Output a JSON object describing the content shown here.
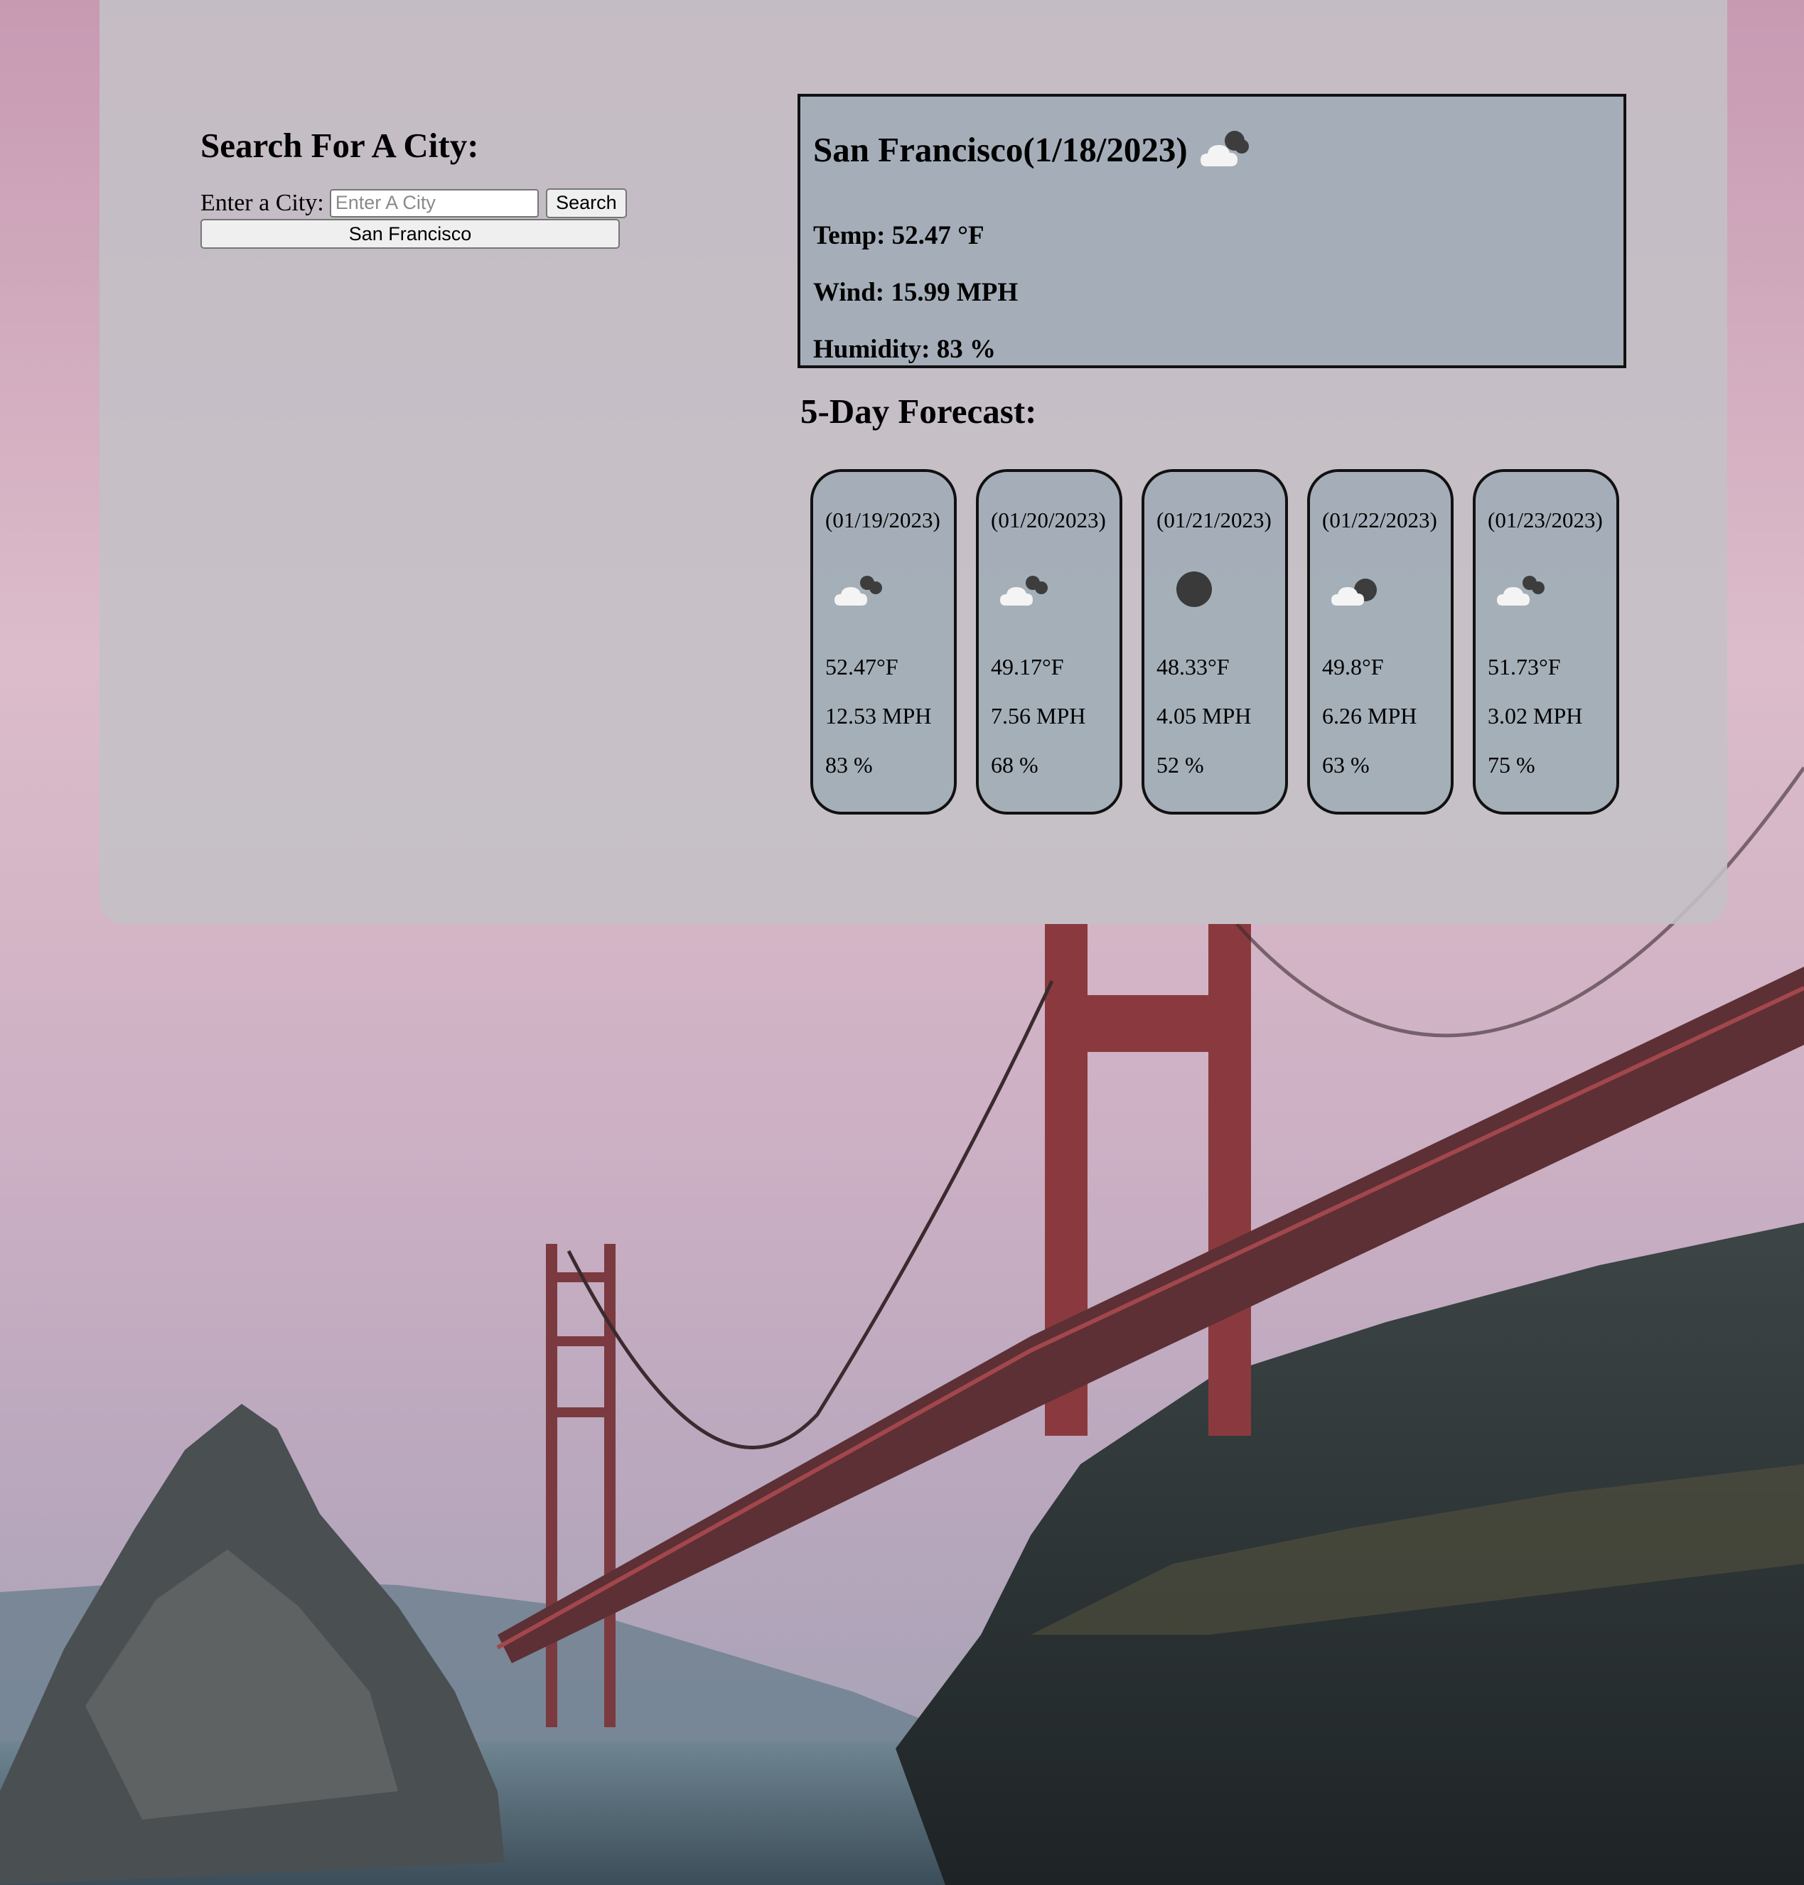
{
  "search": {
    "heading": "Search For A City:",
    "label": "Enter a City:",
    "placeholder": "Enter A City",
    "button_label": "Search",
    "history": [
      "San Francisco"
    ]
  },
  "current": {
    "city_date": "San Francisco(1/18/2023)",
    "icon": "few-clouds-icon",
    "temp": "Temp: 52.47 °F",
    "wind": "Wind: 15.99 MPH",
    "humidity": "Humidity: 83 %"
  },
  "forecast": {
    "heading": "5-Day Forecast:",
    "days": [
      {
        "date": "(01/19/2023)",
        "icon": "broken-clouds-icon",
        "temp": "52.47°F",
        "wind": "12.53 MPH",
        "humidity": "83 %"
      },
      {
        "date": "(01/20/2023)",
        "icon": "broken-clouds-icon",
        "temp": "49.17°F",
        "wind": "7.56 MPH",
        "humidity": "68 %"
      },
      {
        "date": "(01/21/2023)",
        "icon": "clear-sky-icon",
        "temp": "48.33°F",
        "wind": "4.05 MPH",
        "humidity": "52 %"
      },
      {
        "date": "(01/22/2023)",
        "icon": "few-clouds-icon",
        "temp": "49.8°F",
        "wind": "6.26 MPH",
        "humidity": "63 %"
      },
      {
        "date": "(01/23/2023)",
        "icon": "broken-clouds-icon",
        "temp": "51.73°F",
        "wind": "3.02 MPH",
        "humidity": "75 %"
      }
    ]
  },
  "colors": {
    "panel": "#c4c0c6",
    "card": "#a0acb6",
    "border": "#111111",
    "bridge": "#8a3a3e"
  }
}
